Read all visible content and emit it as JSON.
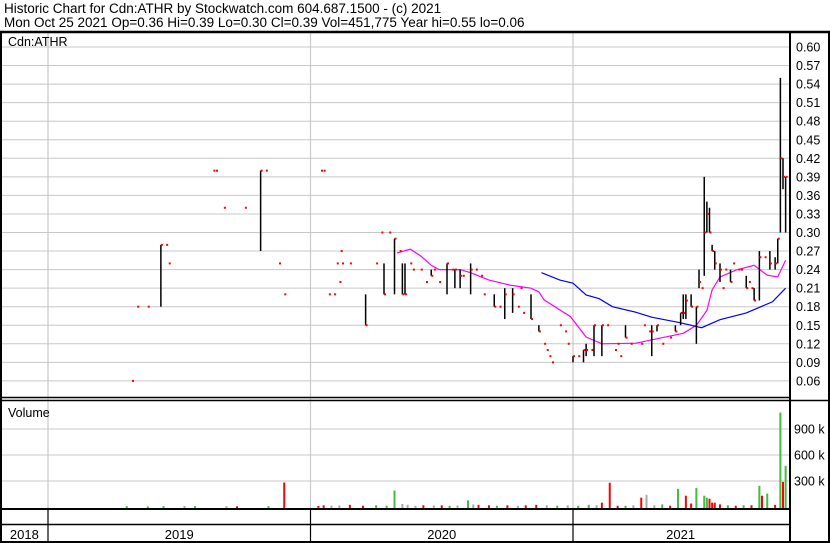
{
  "header": {
    "line1": "Historic Chart for Cdn:ATHR by Stockwatch.com 604.687.1500 - (c) 2021",
    "line2": "Mon Oct 25 2021   Op=0.36   Hi=0.39   Lo=0.30   Cl=0.39   Vol=451,775   Year hi=0.55   lo=0.06"
  },
  "colors": {
    "bar": "#000000",
    "close": "#ff0000",
    "ma_short": "#ff00ff",
    "ma_long": "#0000ff",
    "vol_up": "#44bb44",
    "vol_down": "#ff0000",
    "vol_flat": "#aaaaaa",
    "grid": "#c8c8c8"
  },
  "chart_data": {
    "type": "ohlc",
    "title": "Historic Chart for Cdn:ATHR",
    "price_panel_label": "Cdn:ATHR",
    "volume_panel_label": "Volume",
    "x_unit": "fractional year",
    "xlim": [
      2018.82,
      2021.83
    ],
    "ylim": [
      0.03,
      0.615
    ],
    "y_ticks": [
      "0.60",
      "0.57",
      "0.54",
      "0.51",
      "0.48",
      "0.45",
      "0.42",
      "0.39",
      "0.36",
      "0.33",
      "0.30",
      "0.27",
      "0.24",
      "0.21",
      "0.18",
      "0.15",
      "0.12",
      "0.09",
      "0.06"
    ],
    "volume_ticks": [
      {
        "value": 900,
        "label": "900 k"
      },
      {
        "value": 600,
        "label": "600 k"
      },
      {
        "value": 300,
        "label": "300 k"
      }
    ],
    "year_labels": [
      {
        "t": 2018.91,
        "label": "2018"
      },
      {
        "t": 2019.5,
        "label": "2019"
      },
      {
        "t": 2020.5,
        "label": "2020"
      },
      {
        "t": 2021.41,
        "label": "2021"
      }
    ],
    "year_dividers": [
      2019,
      2020,
      2021
    ],
    "bars_fields": [
      "t",
      "high",
      "low",
      "close"
    ],
    "bars": [
      [
        2019.32,
        0.06,
        0.06,
        0.06
      ],
      [
        2019.34,
        0.18,
        0.18,
        0.18
      ],
      [
        2019.38,
        0.18,
        0.18,
        0.18
      ],
      [
        2019.43,
        0.28,
        0.18,
        0.28
      ],
      [
        2019.45,
        0.28,
        0.28,
        0.28
      ],
      [
        2019.46,
        0.25,
        0.25,
        0.25
      ],
      [
        2019.63,
        0.4,
        0.4,
        0.4
      ],
      [
        2019.64,
        0.4,
        0.4,
        0.4
      ],
      [
        2019.67,
        0.34,
        0.34,
        0.34
      ],
      [
        2019.75,
        0.34,
        0.34,
        0.34
      ],
      [
        2019.81,
        0.4,
        0.27,
        0.4
      ],
      [
        2019.83,
        0.4,
        0.4,
        0.4
      ],
      [
        2019.88,
        0.25,
        0.25,
        0.25
      ],
      [
        2019.9,
        0.2,
        0.2,
        0.2
      ],
      [
        2020.04,
        0.4,
        0.4,
        0.4
      ],
      [
        2020.05,
        0.4,
        0.4,
        0.4
      ],
      [
        2020.07,
        0.2,
        0.2,
        0.2
      ],
      [
        2020.09,
        0.2,
        0.2,
        0.2
      ],
      [
        2020.1,
        0.25,
        0.25,
        0.25
      ],
      [
        2020.11,
        0.22,
        0.22,
        0.22
      ],
      [
        2020.115,
        0.27,
        0.27,
        0.27
      ],
      [
        2020.12,
        0.25,
        0.25,
        0.25
      ],
      [
        2020.15,
        0.25,
        0.25,
        0.25
      ],
      [
        2020.21,
        0.2,
        0.15,
        0.15
      ],
      [
        2020.25,
        0.25,
        0.25,
        0.25
      ],
      [
        2020.27,
        0.3,
        0.3,
        0.3
      ],
      [
        2020.28,
        0.25,
        0.2,
        0.2
      ],
      [
        2020.3,
        0.3,
        0.3,
        0.3
      ],
      [
        2020.32,
        0.29,
        0.2,
        0.29
      ],
      [
        2020.34,
        0.27,
        0.27,
        0.27
      ],
      [
        2020.35,
        0.25,
        0.2,
        0.2
      ],
      [
        2020.36,
        0.25,
        0.2,
        0.2
      ],
      [
        2020.38,
        0.25,
        0.25,
        0.25
      ],
      [
        2020.39,
        0.24,
        0.24,
        0.24
      ],
      [
        2020.42,
        0.24,
        0.24,
        0.24
      ],
      [
        2020.44,
        0.22,
        0.22,
        0.22
      ],
      [
        2020.46,
        0.24,
        0.23,
        0.23
      ],
      [
        2020.47,
        0.24,
        0.24,
        0.24
      ],
      [
        2020.49,
        0.22,
        0.22,
        0.22
      ],
      [
        2020.52,
        0.25,
        0.2,
        0.25
      ],
      [
        2020.54,
        0.24,
        0.24,
        0.24
      ],
      [
        2020.55,
        0.24,
        0.21,
        0.24
      ],
      [
        2020.57,
        0.24,
        0.21,
        0.23
      ],
      [
        2020.58,
        0.23,
        0.23,
        0.23
      ],
      [
        2020.61,
        0.25,
        0.2,
        0.24
      ],
      [
        2020.63,
        0.24,
        0.24,
        0.24
      ],
      [
        2020.65,
        0.23,
        0.23,
        0.23
      ],
      [
        2020.66,
        0.2,
        0.2,
        0.2
      ],
      [
        2020.7,
        0.2,
        0.18,
        0.18
      ],
      [
        2020.72,
        0.18,
        0.18,
        0.18
      ],
      [
        2020.74,
        0.21,
        0.16,
        0.2
      ],
      [
        2020.77,
        0.21,
        0.17,
        0.2
      ],
      [
        2020.79,
        0.18,
        0.18,
        0.18
      ],
      [
        2020.8,
        0.21,
        0.21,
        0.21
      ],
      [
        2020.81,
        0.17,
        0.17,
        0.17
      ],
      [
        2020.84,
        0.2,
        0.16,
        0.16
      ],
      [
        2020.87,
        0.15,
        0.14,
        0.14
      ],
      [
        2020.89,
        0.12,
        0.12,
        0.12
      ],
      [
        2020.9,
        0.11,
        0.11,
        0.11
      ],
      [
        2020.91,
        0.1,
        0.1,
        0.1
      ],
      [
        2020.92,
        0.09,
        0.09,
        0.09
      ],
      [
        2020.95,
        0.15,
        0.15,
        0.15
      ],
      [
        2020.97,
        0.14,
        0.14,
        0.14
      ],
      [
        2020.98,
        0.12,
        0.12,
        0.12
      ],
      [
        2021.0,
        0.1,
        0.09,
        0.1
      ],
      [
        2021.02,
        0.1,
        0.1,
        0.1
      ],
      [
        2021.04,
        0.11,
        0.09,
        0.11
      ],
      [
        2021.05,
        0.12,
        0.1,
        0.11
      ],
      [
        2021.07,
        0.11,
        0.11,
        0.11
      ],
      [
        2021.08,
        0.15,
        0.1,
        0.15
      ],
      [
        2021.11,
        0.15,
        0.1,
        0.15
      ],
      [
        2021.13,
        0.15,
        0.15,
        0.15
      ],
      [
        2021.16,
        0.11,
        0.11,
        0.11
      ],
      [
        2021.17,
        0.12,
        0.12,
        0.12
      ],
      [
        2021.18,
        0.1,
        0.1,
        0.1
      ],
      [
        2021.2,
        0.15,
        0.13,
        0.13
      ],
      [
        2021.22,
        0.12,
        0.12,
        0.12
      ],
      [
        2021.26,
        0.12,
        0.12,
        0.12
      ],
      [
        2021.27,
        0.15,
        0.15,
        0.15
      ],
      [
        2021.29,
        0.14,
        0.14,
        0.14
      ],
      [
        2021.3,
        0.15,
        0.1,
        0.14
      ],
      [
        2021.32,
        0.15,
        0.14,
        0.15
      ],
      [
        2021.34,
        0.12,
        0.12,
        0.12
      ],
      [
        2021.37,
        0.13,
        0.13,
        0.13
      ],
      [
        2021.39,
        0.15,
        0.14,
        0.14
      ],
      [
        2021.41,
        0.17,
        0.15,
        0.17
      ],
      [
        2021.42,
        0.2,
        0.16,
        0.17
      ],
      [
        2021.43,
        0.2,
        0.16,
        0.19
      ],
      [
        2021.45,
        0.2,
        0.18,
        0.18
      ],
      [
        2021.47,
        0.18,
        0.12,
        0.18
      ],
      [
        2021.48,
        0.24,
        0.21,
        0.22
      ],
      [
        2021.49,
        0.21,
        0.21,
        0.21
      ],
      [
        2021.5,
        0.39,
        0.23,
        0.3
      ],
      [
        2021.51,
        0.35,
        0.3,
        0.33
      ],
      [
        2021.52,
        0.34,
        0.3,
        0.3
      ],
      [
        2021.53,
        0.28,
        0.27,
        0.27
      ],
      [
        2021.54,
        0.27,
        0.24,
        0.25
      ],
      [
        2021.56,
        0.25,
        0.22,
        0.24
      ],
      [
        2021.57,
        0.21,
        0.21,
        0.21
      ],
      [
        2021.58,
        0.24,
        0.24,
        0.24
      ],
      [
        2021.6,
        0.24,
        0.22,
        0.22
      ],
      [
        2021.61,
        0.25,
        0.25,
        0.25
      ],
      [
        2021.63,
        0.24,
        0.24,
        0.24
      ],
      [
        2021.64,
        0.24,
        0.24,
        0.24
      ],
      [
        2021.66,
        0.23,
        0.21,
        0.21
      ],
      [
        2021.67,
        0.22,
        0.22,
        0.22
      ],
      [
        2021.68,
        0.21,
        0.21,
        0.21
      ],
      [
        2021.69,
        0.21,
        0.19,
        0.19
      ],
      [
        2021.71,
        0.27,
        0.19,
        0.26
      ],
      [
        2021.73,
        0.26,
        0.26,
        0.26
      ],
      [
        2021.75,
        0.27,
        0.24,
        0.25
      ],
      [
        2021.77,
        0.26,
        0.24,
        0.25
      ],
      [
        2021.78,
        0.29,
        0.25,
        0.29
      ],
      [
        2021.79,
        0.55,
        0.3,
        0.42
      ],
      [
        2021.8,
        0.42,
        0.37,
        0.39
      ],
      [
        2021.81,
        0.39,
        0.3,
        0.39
      ]
    ],
    "ma_short": [
      [
        2020.33,
        0.267
      ],
      [
        2020.38,
        0.273
      ],
      [
        2020.42,
        0.262
      ],
      [
        2020.46,
        0.247
      ],
      [
        2020.49,
        0.24
      ],
      [
        2020.57,
        0.24
      ],
      [
        2020.61,
        0.235
      ],
      [
        2020.68,
        0.223
      ],
      [
        2020.76,
        0.215
      ],
      [
        2020.84,
        0.21
      ],
      [
        2020.87,
        0.204
      ],
      [
        2020.89,
        0.191
      ],
      [
        2020.99,
        0.164
      ],
      [
        2021.05,
        0.131
      ],
      [
        2021.11,
        0.12
      ],
      [
        2021.24,
        0.121
      ],
      [
        2021.33,
        0.129
      ],
      [
        2021.42,
        0.137
      ],
      [
        2021.47,
        0.15
      ],
      [
        2021.51,
        0.174
      ],
      [
        2021.53,
        0.207
      ],
      [
        2021.56,
        0.228
      ],
      [
        2021.62,
        0.239
      ],
      [
        2021.69,
        0.247
      ],
      [
        2021.74,
        0.231
      ],
      [
        2021.78,
        0.228
      ],
      [
        2021.81,
        0.255
      ]
    ],
    "ma_long": [
      [
        2020.88,
        0.235
      ],
      [
        2020.95,
        0.223
      ],
      [
        2021.0,
        0.218
      ],
      [
        2021.05,
        0.199
      ],
      [
        2021.1,
        0.193
      ],
      [
        2021.15,
        0.18
      ],
      [
        2021.24,
        0.171
      ],
      [
        2021.3,
        0.163
      ],
      [
        2021.41,
        0.154
      ],
      [
        2021.49,
        0.146
      ],
      [
        2021.56,
        0.159
      ],
      [
        2021.66,
        0.17
      ],
      [
        2021.76,
        0.188
      ],
      [
        2021.81,
        0.21
      ]
    ],
    "volume_unit": "thousands",
    "volume_fields": [
      "t",
      "volume_k",
      "direction"
    ],
    "volume": [
      [
        2019.3,
        10,
        "up"
      ],
      [
        2019.38,
        8,
        "up"
      ],
      [
        2019.44,
        10,
        "up"
      ],
      [
        2019.52,
        12,
        "flat"
      ],
      [
        2019.56,
        10,
        "up"
      ],
      [
        2019.68,
        10,
        "flat"
      ],
      [
        2019.72,
        8,
        "down"
      ],
      [
        2019.84,
        10,
        "up"
      ],
      [
        2019.9,
        283,
        "down"
      ],
      [
        2020.03,
        12,
        "down"
      ],
      [
        2020.05,
        20,
        "down"
      ],
      [
        2020.08,
        15,
        "flat"
      ],
      [
        2020.11,
        18,
        "flat"
      ],
      [
        2020.15,
        25,
        "down"
      ],
      [
        2020.2,
        15,
        "down"
      ],
      [
        2020.25,
        20,
        "up"
      ],
      [
        2020.29,
        15,
        "up"
      ],
      [
        2020.32,
        190,
        "up"
      ],
      [
        2020.35,
        35,
        "flat"
      ],
      [
        2020.37,
        25,
        "flat"
      ],
      [
        2020.4,
        15,
        "flat"
      ],
      [
        2020.43,
        20,
        "down"
      ],
      [
        2020.47,
        18,
        "flat"
      ],
      [
        2020.5,
        20,
        "down"
      ],
      [
        2020.53,
        15,
        "up"
      ],
      [
        2020.56,
        18,
        "flat"
      ],
      [
        2020.6,
        76,
        "up"
      ],
      [
        2020.62,
        30,
        "flat"
      ],
      [
        2020.64,
        25,
        "down"
      ],
      [
        2020.68,
        20,
        "down"
      ],
      [
        2020.71,
        15,
        "up"
      ],
      [
        2020.75,
        20,
        "down"
      ],
      [
        2020.79,
        15,
        "flat"
      ],
      [
        2020.82,
        20,
        "down"
      ],
      [
        2020.86,
        25,
        "down"
      ],
      [
        2020.9,
        20,
        "flat"
      ],
      [
        2020.94,
        15,
        "up"
      ],
      [
        2020.98,
        20,
        "flat"
      ],
      [
        2021.02,
        15,
        "up"
      ],
      [
        2021.06,
        25,
        "up"
      ],
      [
        2021.09,
        20,
        "flat"
      ],
      [
        2021.11,
        50,
        "down"
      ],
      [
        2021.14,
        280,
        "down"
      ],
      [
        2021.17,
        15,
        "down"
      ],
      [
        2021.2,
        15,
        "up"
      ],
      [
        2021.23,
        20,
        "flat"
      ],
      [
        2021.26,
        108,
        "down"
      ],
      [
        2021.28,
        140,
        "flat"
      ],
      [
        2021.31,
        20,
        "flat"
      ],
      [
        2021.34,
        30,
        "up"
      ],
      [
        2021.37,
        15,
        "down"
      ],
      [
        2021.4,
        210,
        "up"
      ],
      [
        2021.43,
        130,
        "down"
      ],
      [
        2021.45,
        40,
        "down"
      ],
      [
        2021.47,
        220,
        "up"
      ],
      [
        2021.5,
        130,
        "up"
      ],
      [
        2021.51,
        108,
        "up"
      ],
      [
        2021.52,
        95,
        "down"
      ],
      [
        2021.53,
        50,
        "down"
      ],
      [
        2021.54,
        50,
        "down"
      ],
      [
        2021.56,
        30,
        "down"
      ],
      [
        2021.59,
        20,
        "up"
      ],
      [
        2021.62,
        15,
        "down"
      ],
      [
        2021.65,
        20,
        "up"
      ],
      [
        2021.68,
        20,
        "down"
      ],
      [
        2021.71,
        245,
        "up"
      ],
      [
        2021.72,
        130,
        "down"
      ],
      [
        2021.74,
        155,
        "up"
      ],
      [
        2021.77,
        25,
        "down"
      ],
      [
        2021.79,
        1090,
        "up"
      ],
      [
        2021.8,
        290,
        "down"
      ],
      [
        2021.81,
        475,
        "up"
      ]
    ]
  }
}
